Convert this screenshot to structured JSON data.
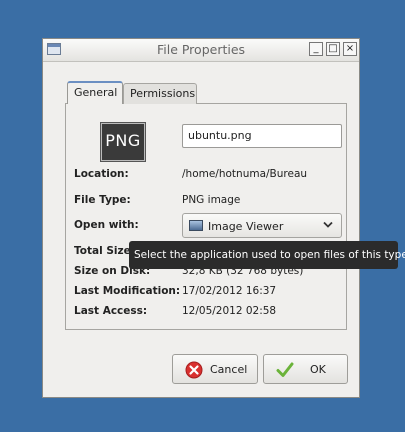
{
  "window": {
    "title": "File Properties",
    "minimize_glyph": "_",
    "maximize_glyph": "□",
    "close_glyph": "×"
  },
  "tabs": [
    {
      "label": "General",
      "active": true
    },
    {
      "label": "Permissions",
      "active": false
    }
  ],
  "file": {
    "icon_text": "PNG",
    "name": "ubuntu.png"
  },
  "properties": {
    "location_label": "Location:",
    "location_value": "/home/hotnuma/Bureau",
    "type_label": "File Type:",
    "type_value": "PNG image",
    "open_with_label": "Open with:",
    "open_with_value": "Image Viewer",
    "total_size_label": "Total Size",
    "size_on_disk_label": "Size on Disk:",
    "size_on_disk_value": "32,8 KB  (32 768 bytes)",
    "last_modification_label": "Last Modification:",
    "last_modification_value": "17/02/2012 16:37",
    "last_access_label": "Last Access:",
    "last_access_value": "12/05/2012 02:58"
  },
  "tooltip": "Select the application used to open files of this type",
  "buttons": {
    "cancel_label": "Cancel",
    "ok_label": "OK"
  },
  "icons": {
    "window": "window-icon",
    "application": "image-viewer-icon",
    "dropdown": "chevron-down-icon",
    "cancel": "cancel-icon",
    "ok": "checkmark-icon"
  },
  "colors": {
    "desktop": "#3a6ea5",
    "window": "#f0efed",
    "tooltip": "#2b2b2b",
    "cancel_icon": "#d9302f",
    "ok_icon": "#6bb33a",
    "active_tab_accent": "#6b8fc2"
  }
}
